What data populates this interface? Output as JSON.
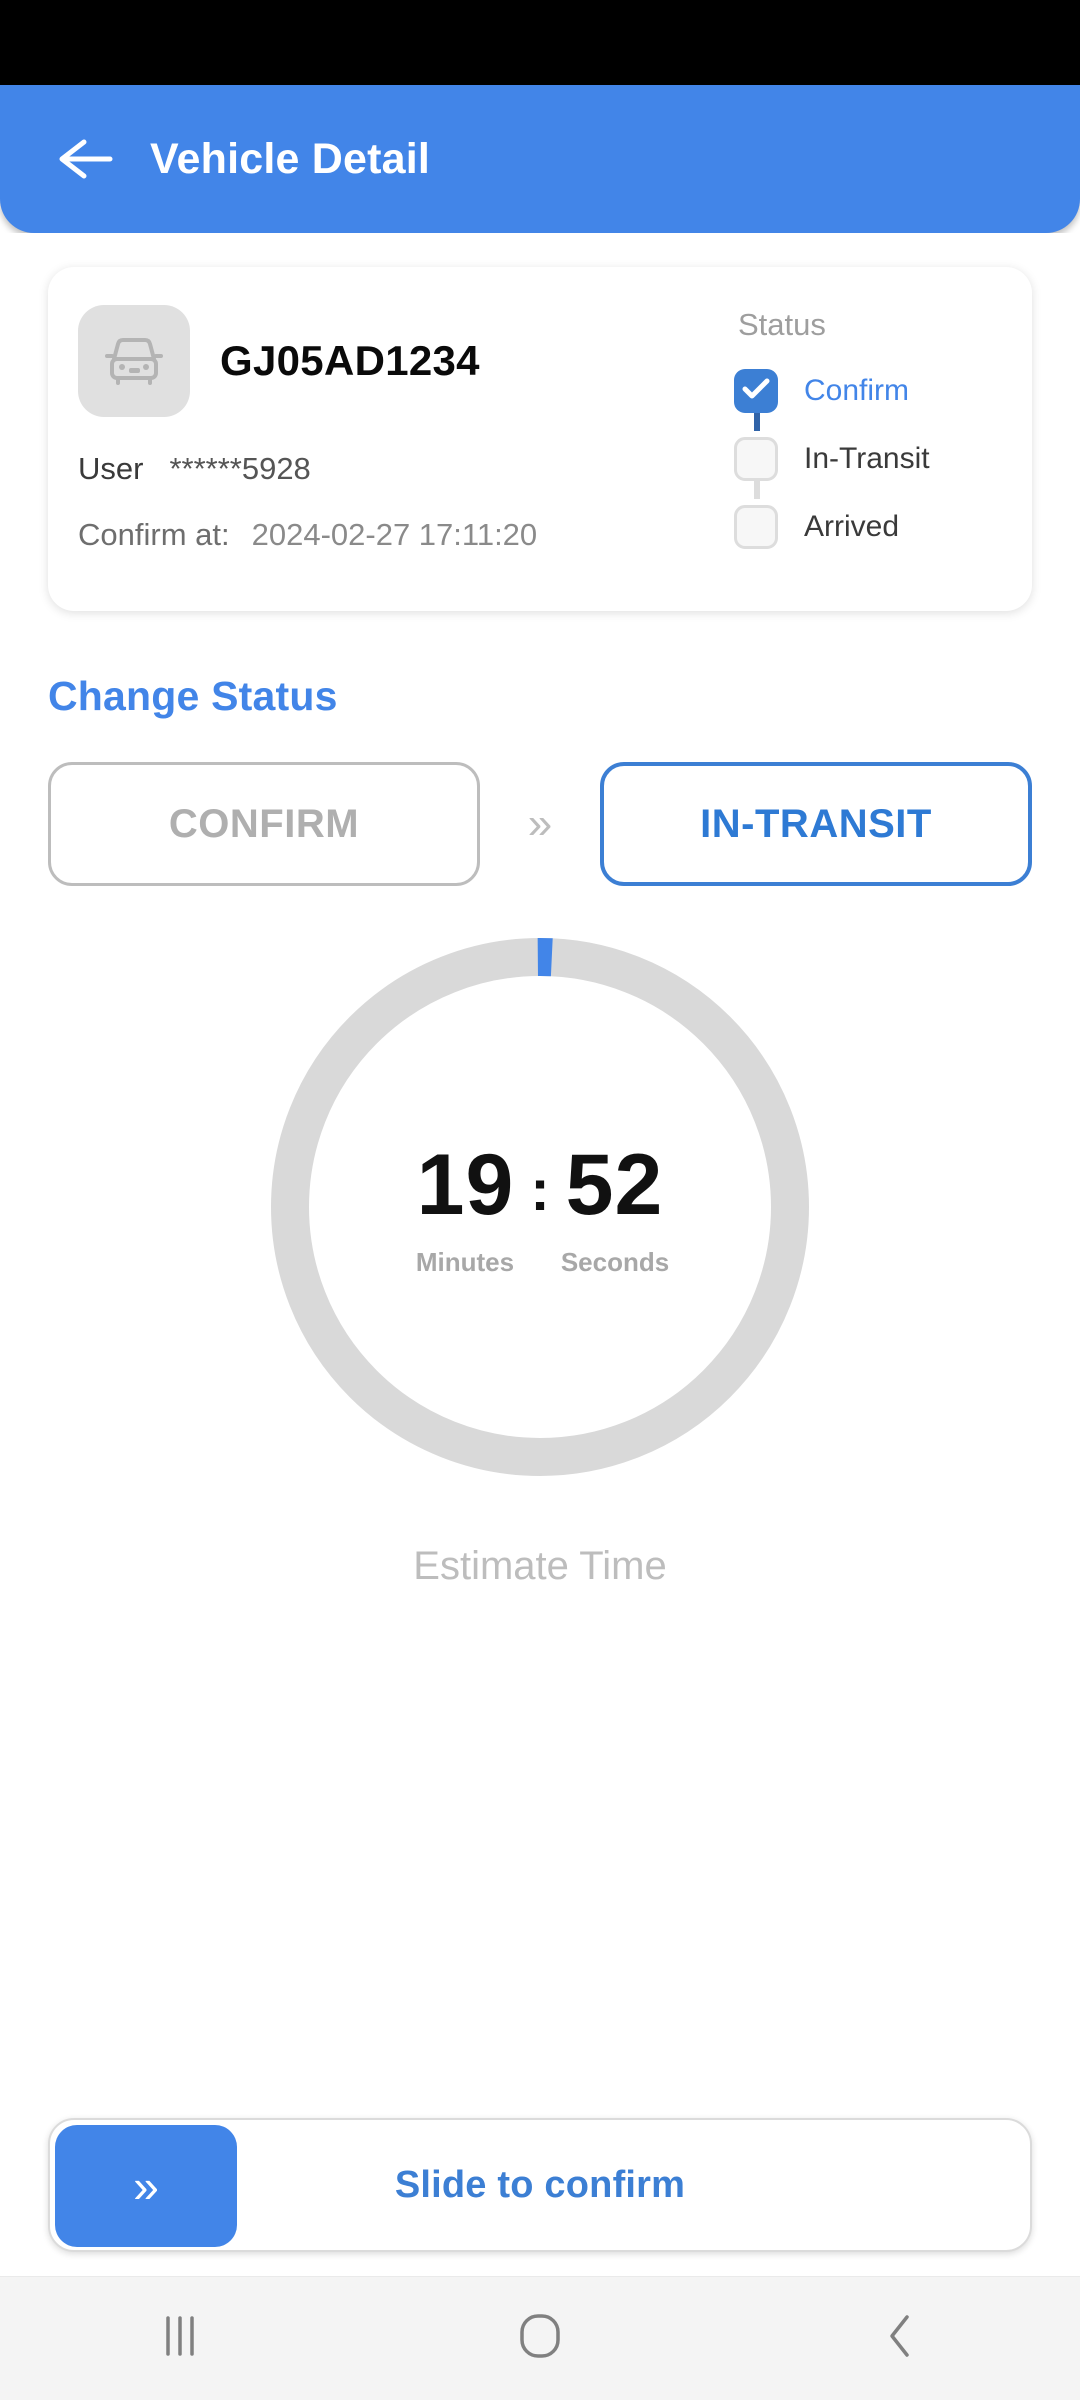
{
  "statusbar": {
    "content": ""
  },
  "appbar": {
    "back_icon": "arrow-left-icon",
    "title": "Vehicle Detail",
    "bg_color": "#4285E8"
  },
  "vehicle_card": {
    "vehicle_icon": "car-icon",
    "plate_number": "GJ05AD1234",
    "user_label": "User",
    "user_value": "******5928",
    "confirm_at_label": "Confirm at:",
    "confirm_at_value": "2024-02-27 17:11:20",
    "status": {
      "title": "Status",
      "steps": [
        {
          "label": "Confirm",
          "state": "done",
          "checked": true
        },
        {
          "label": "In-Transit",
          "state": "todo",
          "checked": false
        },
        {
          "label": "Arrived",
          "state": "todo",
          "checked": false
        }
      ]
    }
  },
  "change_status": {
    "title": "Change Status",
    "from_label": "CONFIRM",
    "arrow_icon": "double-chevron-right-icon",
    "arrow_glyph": "»",
    "to_label": "IN-TRANSIT",
    "accent_color": "#4285E8"
  },
  "timer": {
    "minutes": "19",
    "separator": ":",
    "seconds": "52",
    "minutes_label": "Minutes",
    "seconds_label": "Seconds",
    "caption": "Estimate Time",
    "track_color": "#D9D9D9",
    "progress_color": "#4285E8",
    "progress_percent": 1
  },
  "slider": {
    "handle_icon": "double-chevron-right-icon",
    "handle_glyph": "»",
    "label": "Slide to confirm",
    "handle_color": "#4285E8"
  },
  "navbar": {
    "recents_icon": "recents-icon",
    "home_icon": "home-icon",
    "back_icon": "back-chevron-icon"
  }
}
